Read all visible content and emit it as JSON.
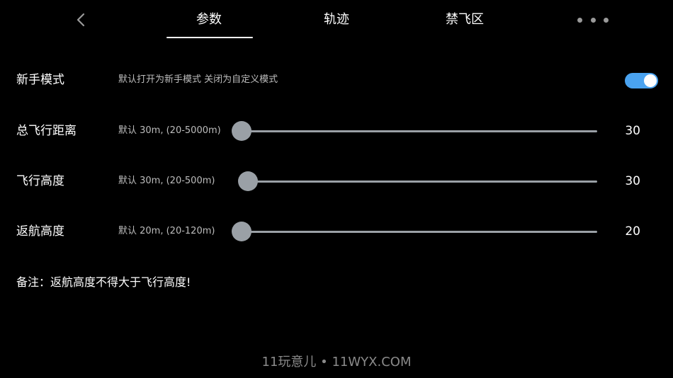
{
  "nav": {
    "tabs": [
      {
        "label": "参数",
        "active": true
      },
      {
        "label": "轨迹",
        "active": false
      },
      {
        "label": "禁飞区",
        "active": false
      }
    ],
    "back_icon": "chevron-left-icon",
    "more_icon": "more-horizontal-icon"
  },
  "settings": {
    "novice_mode": {
      "label": "新手模式",
      "hint": "默认打开为新手模式 关闭为自定义模式",
      "enabled": true
    },
    "total_distance": {
      "label": "总飞行距离",
      "hint": "默认 30m, (20-5000m)",
      "value": "30",
      "min": 20,
      "max": 5000,
      "current": 30
    },
    "flight_altitude": {
      "label": "飞行高度",
      "hint": "默认 30m, (20-500m)",
      "value": "30",
      "min": 20,
      "max": 500,
      "current": 30
    },
    "return_altitude": {
      "label": "返航高度",
      "hint": "默认 20m, (20-120m)",
      "value": "20",
      "min": 20,
      "max": 120,
      "current": 20
    }
  },
  "note": "备注：返航高度不得大于飞行高度!",
  "watermark": "11玩意儿 • 11WYX.COM",
  "colors": {
    "background": "#000000",
    "accent": "#4aa3f0",
    "slider": "#9aa0a6"
  }
}
